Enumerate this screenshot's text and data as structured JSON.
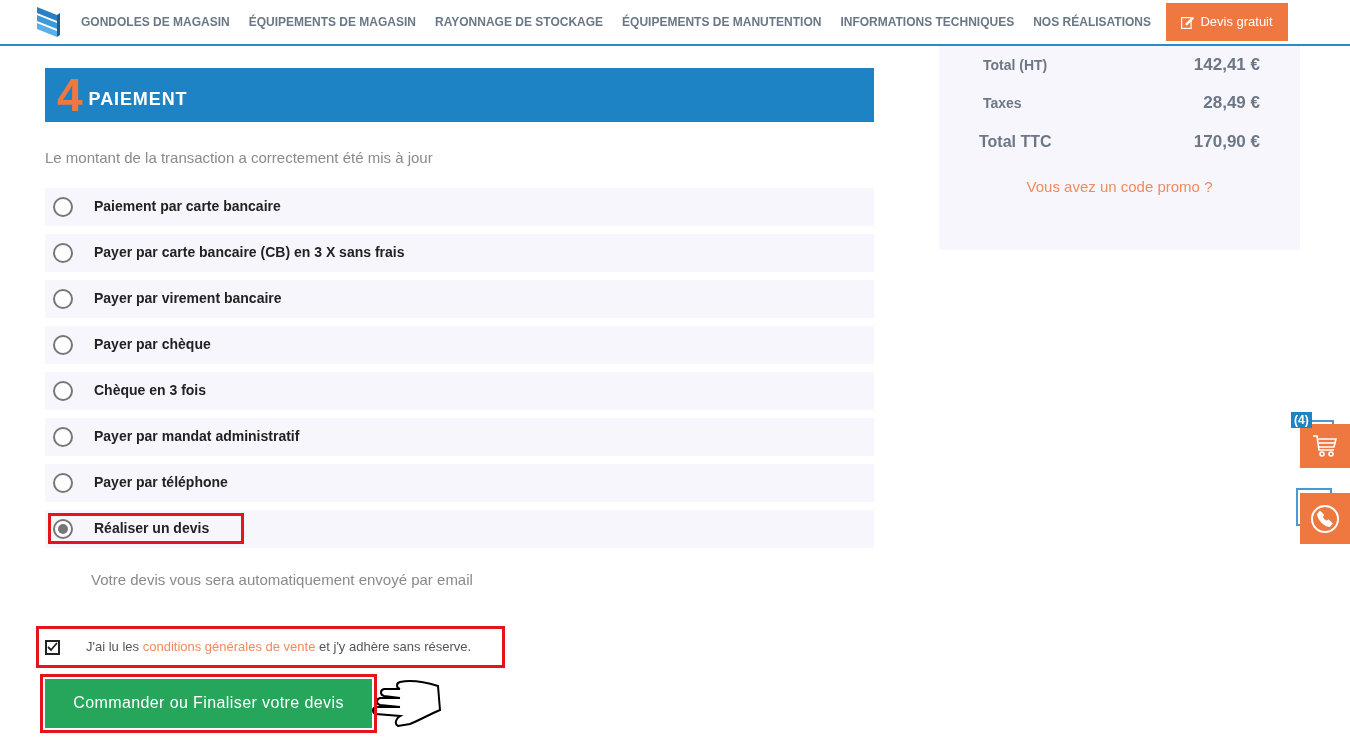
{
  "nav": {
    "items": [
      "GONDOLES DE MAGASIN",
      "ÉQUIPEMENTS DE MAGASIN",
      "RAYONNAGE DE STOCKAGE",
      "ÉQUIPEMENTS DE MANUTENTION",
      "INFORMATIONS TECHNIQUES",
      "NOS RÉALISATIONS"
    ],
    "cta": "Devis gratuit"
  },
  "section": {
    "number": "4",
    "title": "PAIEMENT"
  },
  "notice": "Le montant de la transaction a correctement été mis à jour",
  "options": [
    {
      "label": "Paiement par carte bancaire",
      "selected": false,
      "annotated": false
    },
    {
      "label": "Payer par carte bancaire (CB) en 3 X sans frais",
      "selected": false,
      "annotated": false
    },
    {
      "label": "Payer par virement bancaire",
      "selected": false,
      "annotated": false
    },
    {
      "label": "Payer par chèque",
      "selected": false,
      "annotated": false
    },
    {
      "label": "Chèque en 3 fois",
      "selected": false,
      "annotated": false
    },
    {
      "label": "Payer par mandat administratif",
      "selected": false,
      "annotated": false
    },
    {
      "label": "Payer par téléphone",
      "selected": false,
      "annotated": false
    },
    {
      "label": "Réaliser un devis",
      "selected": true,
      "annotated": true
    }
  ],
  "option_note": "Votre devis vous sera automatiquement envoyé par email",
  "terms": {
    "checked": true,
    "annotated": true,
    "before": "J'ai lu les",
    "link": "conditions générales de vente",
    "after": "et j'y adhère sans réserve."
  },
  "submit": {
    "label": "Commander ou Finaliser votre devis",
    "annotated": true
  },
  "summary": {
    "rows": [
      {
        "label": "Total (HT)",
        "value": "142,41 €",
        "kind": "plain"
      },
      {
        "label": "Taxes",
        "value": "28,49 €",
        "kind": "plain"
      },
      {
        "label": "Total TTC",
        "value": "170,90 €",
        "kind": "total"
      }
    ],
    "promo": "Vous avez un code promo ?"
  },
  "cart": {
    "count": "(4)"
  }
}
